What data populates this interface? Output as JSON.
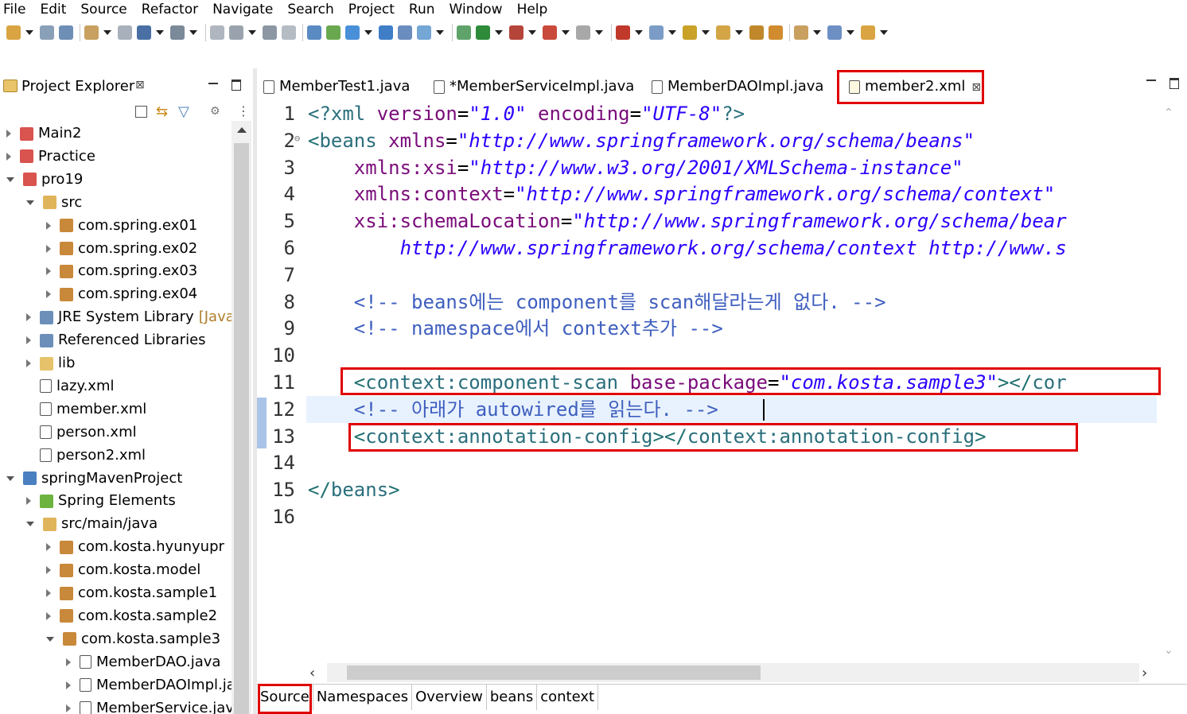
{
  "menu": [
    "File",
    "Edit",
    "Source",
    "Refactor",
    "Navigate",
    "Search",
    "Project",
    "Run",
    "Window",
    "Help"
  ],
  "explorer": {
    "title": "Project Explorer",
    "tree": [
      {
        "label": "Main2",
        "indent": 0,
        "expander": "closed",
        "icon": "project-icon"
      },
      {
        "label": "Practice",
        "indent": 0,
        "expander": "closed",
        "icon": "project-icon"
      },
      {
        "label": "pro19",
        "indent": 0,
        "expander": "open",
        "icon": "project-icon"
      },
      {
        "label": "src",
        "indent": 1,
        "expander": "open",
        "icon": "source-folder-icon"
      },
      {
        "label": "com.spring.ex01",
        "indent": 2,
        "expander": "closed",
        "icon": "package-icon"
      },
      {
        "label": "com.spring.ex02",
        "indent": 2,
        "expander": "closed",
        "icon": "package-icon"
      },
      {
        "label": "com.spring.ex03",
        "indent": 2,
        "expander": "closed",
        "icon": "package-icon"
      },
      {
        "label": "com.spring.ex04",
        "indent": 2,
        "expander": "closed",
        "icon": "package-icon"
      },
      {
        "label": "JRE System Library",
        "suffix": "[JavaS",
        "indent": 1,
        "expander": "closed",
        "icon": "library-icon"
      },
      {
        "label": "Referenced Libraries",
        "indent": 1,
        "expander": "closed",
        "icon": "library-icon"
      },
      {
        "label": "lib",
        "indent": 1,
        "expander": "closed",
        "icon": "folder-icon"
      },
      {
        "label": "lazy.xml",
        "indent": 1,
        "expander": "none",
        "icon": "xml-file-icon"
      },
      {
        "label": "member.xml",
        "indent": 1,
        "expander": "none",
        "icon": "xml-file-icon"
      },
      {
        "label": "person.xml",
        "indent": 1,
        "expander": "none",
        "icon": "xml-file-icon"
      },
      {
        "label": "person2.xml",
        "indent": 1,
        "expander": "none",
        "icon": "xml-file-icon"
      },
      {
        "label": "springMavenProject",
        "indent": 0,
        "expander": "open",
        "icon": "maven-project-icon"
      },
      {
        "label": "Spring Elements",
        "indent": 1,
        "expander": "closed",
        "icon": "spring-leaf-icon"
      },
      {
        "label": "src/main/java",
        "indent": 1,
        "expander": "open",
        "icon": "source-folder-icon"
      },
      {
        "label": "com.kosta.hyunyupr",
        "indent": 2,
        "expander": "closed",
        "icon": "package-icon"
      },
      {
        "label": "com.kosta.model",
        "indent": 2,
        "expander": "closed",
        "icon": "package-icon"
      },
      {
        "label": "com.kosta.sample1",
        "indent": 2,
        "expander": "closed",
        "icon": "package-icon"
      },
      {
        "label": "com.kosta.sample2",
        "indent": 2,
        "expander": "closed",
        "icon": "package-icon"
      },
      {
        "label": "com.kosta.sample3",
        "indent": 2,
        "expander": "open",
        "icon": "package-icon"
      },
      {
        "label": "MemberDAO.java",
        "indent": 3,
        "expander": "closed",
        "icon": "java-interface-icon"
      },
      {
        "label": "MemberDAOImpl.ja",
        "indent": 3,
        "expander": "closed",
        "icon": "java-class-icon"
      },
      {
        "label": "MemberService.java",
        "indent": 3,
        "expander": "closed",
        "icon": "java-interface-icon"
      }
    ]
  },
  "tabs": [
    {
      "label": "MemberTest1.java",
      "icon": "java-file-icon",
      "active": false
    },
    {
      "label": "*MemberServiceImpl.java",
      "icon": "java-file-icon",
      "active": false
    },
    {
      "label": "MemberDAOImpl.java",
      "icon": "java-file-icon",
      "active": false
    },
    {
      "label": "member2.xml",
      "icon": "xml-file-icon",
      "active": true,
      "close": "⊠"
    }
  ],
  "code": [
    {
      "n": "1",
      "marker": "",
      "parts": [
        [
          "pi",
          "<?xml "
        ],
        [
          "attr",
          "version"
        ],
        [
          "eq",
          "="
        ],
        [
          "str",
          "\"1.0\""
        ],
        [
          "pi",
          " "
        ],
        [
          "attr",
          "encoding"
        ],
        [
          "eq",
          "="
        ],
        [
          "str",
          "\"UTF-8\""
        ],
        [
          "pi",
          "?>"
        ]
      ]
    },
    {
      "n": "2",
      "marker": "⊖",
      "parts": [
        [
          "brk",
          "<"
        ],
        [
          "tag",
          "beans "
        ],
        [
          "attr",
          "xmlns"
        ],
        [
          "eq",
          "="
        ],
        [
          "str",
          "\"http://www.springframework.org/schema/beans\""
        ]
      ]
    },
    {
      "n": "3",
      "marker": "",
      "parts": [
        [
          "tag",
          "    "
        ],
        [
          "attr",
          "xmlns:xsi"
        ],
        [
          "eq",
          "="
        ],
        [
          "str",
          "\"http://www.w3.org/2001/XMLSchema-instance\""
        ]
      ]
    },
    {
      "n": "4",
      "marker": "",
      "parts": [
        [
          "tag",
          "    "
        ],
        [
          "attr",
          "xmlns:context"
        ],
        [
          "eq",
          "="
        ],
        [
          "str",
          "\"http://www.springframework.org/schema/context\""
        ]
      ]
    },
    {
      "n": "5",
      "marker": "",
      "parts": [
        [
          "tag",
          "    "
        ],
        [
          "attr",
          "xsi:schemaLocation"
        ],
        [
          "eq",
          "="
        ],
        [
          "str",
          "\"http://www.springframework.org/schema/bear"
        ]
      ]
    },
    {
      "n": "6",
      "marker": "",
      "parts": [
        [
          "tag",
          "        "
        ],
        [
          "str",
          "http://www.springframework.org/schema/context http://www.s"
        ]
      ]
    },
    {
      "n": "7",
      "marker": "",
      "parts": []
    },
    {
      "n": "8",
      "marker": "",
      "parts": [
        [
          "com",
          "    <!-- beans에는 component를 scan해달라는게 없다. -->"
        ]
      ]
    },
    {
      "n": "9",
      "marker": "",
      "parts": [
        [
          "com",
          "    <!-- namespace에서 context추가 -->"
        ]
      ]
    },
    {
      "n": "10",
      "marker": "",
      "parts": []
    },
    {
      "n": "11",
      "marker": "",
      "parts": [
        [
          "tag",
          "    "
        ],
        [
          "brk",
          "<"
        ],
        [
          "tag",
          "context:component-scan "
        ],
        [
          "attr",
          "base-package"
        ],
        [
          "eq",
          "="
        ],
        [
          "str",
          "\"com.kosta.sample3\""
        ],
        [
          "brk",
          "></"
        ],
        [
          "tag",
          "cor"
        ]
      ]
    },
    {
      "n": "12",
      "marker": "",
      "parts": [
        [
          "com",
          "    <!-- 아래가 autowired를 읽는다. -->"
        ]
      ]
    },
    {
      "n": "13",
      "marker": "",
      "parts": [
        [
          "tag",
          "    "
        ],
        [
          "brk",
          "<"
        ],
        [
          "tag",
          "context:annotation-config"
        ],
        [
          "brk",
          "></"
        ],
        [
          "tag",
          "context:annotation-config"
        ],
        [
          "brk",
          ">"
        ]
      ]
    },
    {
      "n": "14",
      "marker": "",
      "parts": []
    },
    {
      "n": "15",
      "marker": "",
      "parts": [
        [
          "brk",
          "</"
        ],
        [
          "tag",
          "beans"
        ],
        [
          "brk",
          ">"
        ]
      ]
    },
    {
      "n": "16",
      "marker": "",
      "parts": []
    }
  ],
  "bottom_tabs": [
    "Source",
    "Namespaces",
    "Overview",
    "beans",
    "context"
  ],
  "colors": {
    "highlight_box": "#e00000",
    "current_line": "#e8f2fe"
  }
}
